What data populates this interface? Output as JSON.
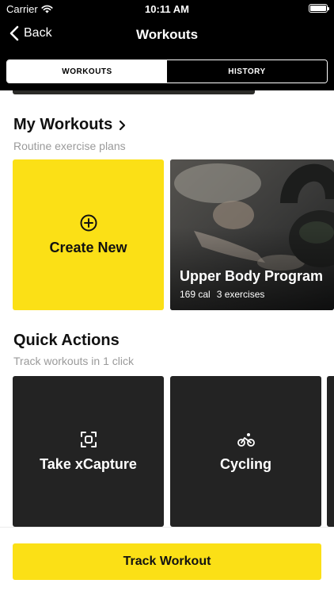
{
  "status_bar": {
    "carrier": "Carrier",
    "time": "10:11 AM",
    "battery_level": 1.0
  },
  "nav": {
    "back_label": "Back",
    "title": "Workouts"
  },
  "segments": {
    "workouts": "WORKOUTS",
    "history": "HISTORY",
    "selected": "workouts"
  },
  "my_workouts": {
    "title": "My Workouts",
    "subtitle": "Routine exercise plans",
    "create_label": "Create New",
    "program": {
      "title": "Upper Body Program",
      "calories": "169 cal",
      "exercises": "3 exercises"
    }
  },
  "quick_actions": {
    "title": "Quick Actions",
    "subtitle": "Track workouts in 1 click",
    "items": [
      {
        "label": "Take xCapture",
        "icon": "scan-icon"
      },
      {
        "label": "Cycling",
        "icon": "bicycle-icon"
      }
    ]
  },
  "bottom": {
    "track_label": "Track Workout"
  },
  "colors": {
    "accent": "#FBE016",
    "card_dark": "#232323",
    "bar": "#000000"
  }
}
